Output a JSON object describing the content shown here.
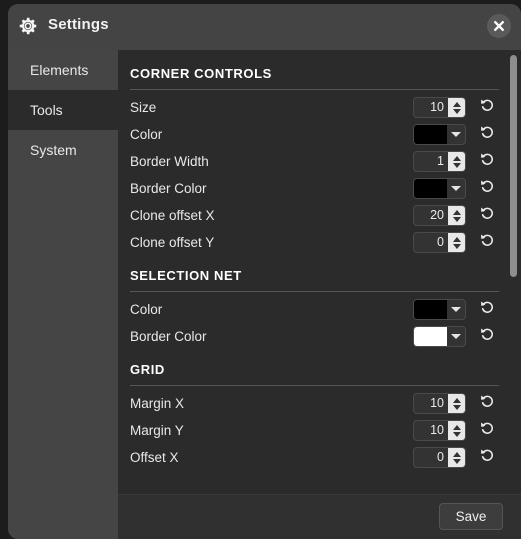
{
  "window": {
    "title": "Settings",
    "gear_icon": "gear-icon",
    "close_icon": "close-icon"
  },
  "sidebar": {
    "items": [
      {
        "label": "Elements",
        "active": false
      },
      {
        "label": "Tools",
        "active": true
      },
      {
        "label": "System",
        "active": false
      }
    ]
  },
  "main": {
    "reset_icon": "reset-icon",
    "sections": [
      {
        "title": "CORNER CONTROLS",
        "rows": [
          {
            "label": "Size",
            "type": "number",
            "value": "10"
          },
          {
            "label": "Color",
            "type": "color",
            "value": "#000000"
          },
          {
            "label": "Border Width",
            "type": "number",
            "value": "1"
          },
          {
            "label": "Border Color",
            "type": "color",
            "value": "#000000"
          },
          {
            "label": "Clone offset X",
            "type": "number",
            "value": "20"
          },
          {
            "label": "Clone offset Y",
            "type": "number",
            "value": "0"
          }
        ]
      },
      {
        "title": "SELECTION NET",
        "rows": [
          {
            "label": "Color",
            "type": "color",
            "value": "#000000"
          },
          {
            "label": "Border Color",
            "type": "color",
            "value": "#ffffff"
          }
        ]
      },
      {
        "title": "GRID",
        "rows": [
          {
            "label": "Margin X",
            "type": "number",
            "value": "10"
          },
          {
            "label": "Margin Y",
            "type": "number",
            "value": "10"
          },
          {
            "label": "Offset X",
            "type": "number",
            "value": "0"
          }
        ]
      }
    ]
  },
  "footer": {
    "save_label": "Save"
  },
  "colors": {
    "window_background": "#3c3c3c",
    "titlebar": "#444444",
    "sidebar": "#454545",
    "content": "#2b2b2b",
    "text": "#e9e9e9",
    "scrollbar_thumb": "#8e8e8e"
  }
}
